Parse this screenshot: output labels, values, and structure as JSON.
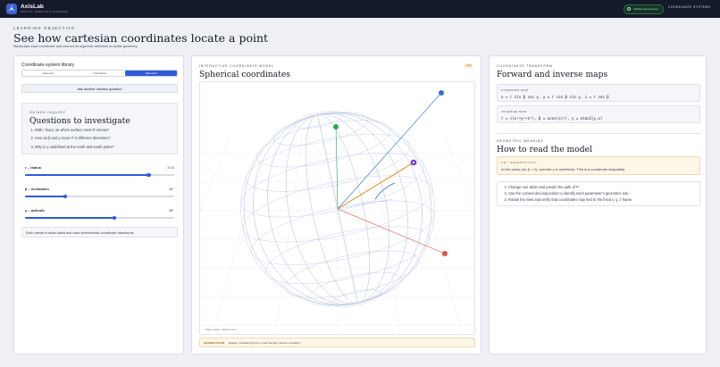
{
  "header": {
    "brand": "AxisLab",
    "brand_sub": "SPATIAL ROBOTICS LEARNING",
    "verified_badge": "Verified visual preset",
    "nav_button": "COORDINATE SYSTEMS"
  },
  "hero": {
    "eyebrow": "LEARNING OBJECTIVE",
    "title": "See how cartesian coordinates locate a point",
    "subtitle": "Manipulate each coordinate and connect its algebraic definition to visible geometry."
  },
  "library": {
    "title": "Coordinate-system library",
    "options": [
      "Cartesian",
      "Cylindrical",
      "Spherical"
    ],
    "selected": "Spherical",
    "ask_button": "Ask another robotics question"
  },
  "inquiry": {
    "eyebrow": "GUIDED INQUIRY",
    "title": "Questions to investigate",
    "questions": [
      "With r fixed, on which surface must P remain?",
      "How do β and γ move P in different directions?",
      "Why is γ undefined at the north and south poles?"
    ]
  },
  "sliders": [
    {
      "label": "r – radius",
      "value_text": "3.00",
      "fraction": 0.83
    },
    {
      "label": "β – inclination",
      "value_text": "46°",
      "fraction": 0.27
    },
    {
      "label": "γ – azimuth",
      "value_text": "38°",
      "fraction": 0.6
    }
  ],
  "preset_note": "Each preset is allow-listed and uses deterministic coordinate transforms.",
  "model": {
    "eyebrow": "INTERACTIVE COORDINATE MODEL",
    "title": "Spherical coordinates",
    "live_pill": "LIVE",
    "hint": "Drag to rotate · Scroll to zoom",
    "observation_label": "OBSERVATION",
    "observation_text": "Radius r, inclination β from +z, and azimuth γ around +z locate P."
  },
  "transform": {
    "eyebrow": "COORDINATE TRANSFORM",
    "title": "Forward and inverse maps",
    "forward_label": "FORWARD MAP",
    "forward_formula": "x = r sin β cos γ,  y = r sin β sin γ,  z = r cos β",
    "inverse_label": "INVERSE MAP",
    "inverse_formula": "r = √(x²+y²+z²),  β = acos(z/r),  γ = atan2(y,x)"
  },
  "meaning": {
    "eyebrow": "GEOMETRIC MEANING",
    "title": "How to read the model",
    "key_label": "KEY OBSERVATION",
    "key_text": "At the poles (sin β = 0), azimuth γ is undefined. This is a coordinate singularity.",
    "steps": [
      "Change one slider and predict the path of P.",
      "Use the colored decomposition to identify each parameter's geometric role.",
      "Rotate the view and verify that coordinates stay tied to the fixed x, y, z frame."
    ]
  },
  "colors": {
    "accent": "#2f5bd8",
    "axis_x": "#e0563f",
    "axis_y": "#2fa45a",
    "axis_z": "#2f6fd8",
    "point": "#7a3fcf",
    "radius": "#e49a2c"
  }
}
